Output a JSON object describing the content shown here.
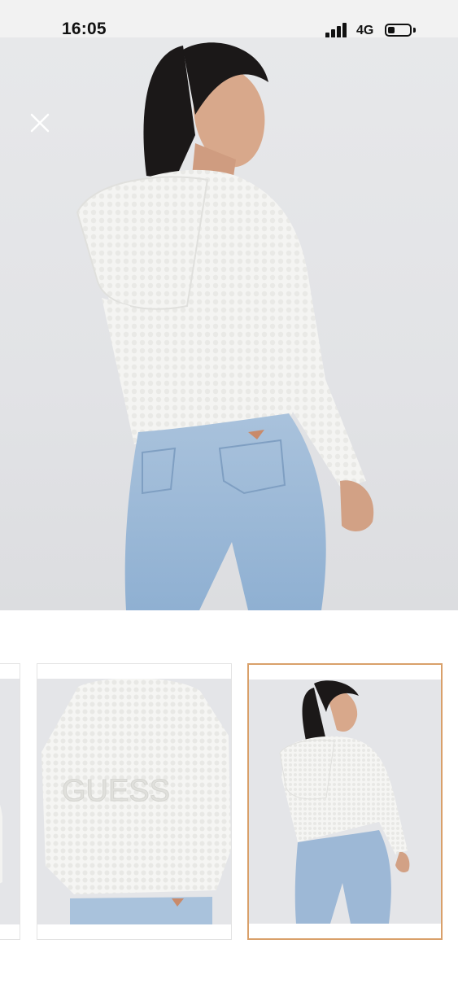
{
  "status_bar": {
    "time": "16:05",
    "network": "4G",
    "signal_icon": "signal-bars-icon",
    "battery_icon": "battery-icon"
  },
  "viewer": {
    "close_icon": "close-icon",
    "hero_image": "product-photo-model-back-view"
  },
  "thumbnails": {
    "items": [
      {
        "name": "thumbnail-1",
        "selected": false
      },
      {
        "name": "thumbnail-2",
        "selected": false
      },
      {
        "name": "thumbnail-3",
        "selected": true
      }
    ]
  },
  "colors": {
    "selected_border": "#d9a06a",
    "thumb_border": "#e3e3e3",
    "background": "#e4e5e8"
  }
}
